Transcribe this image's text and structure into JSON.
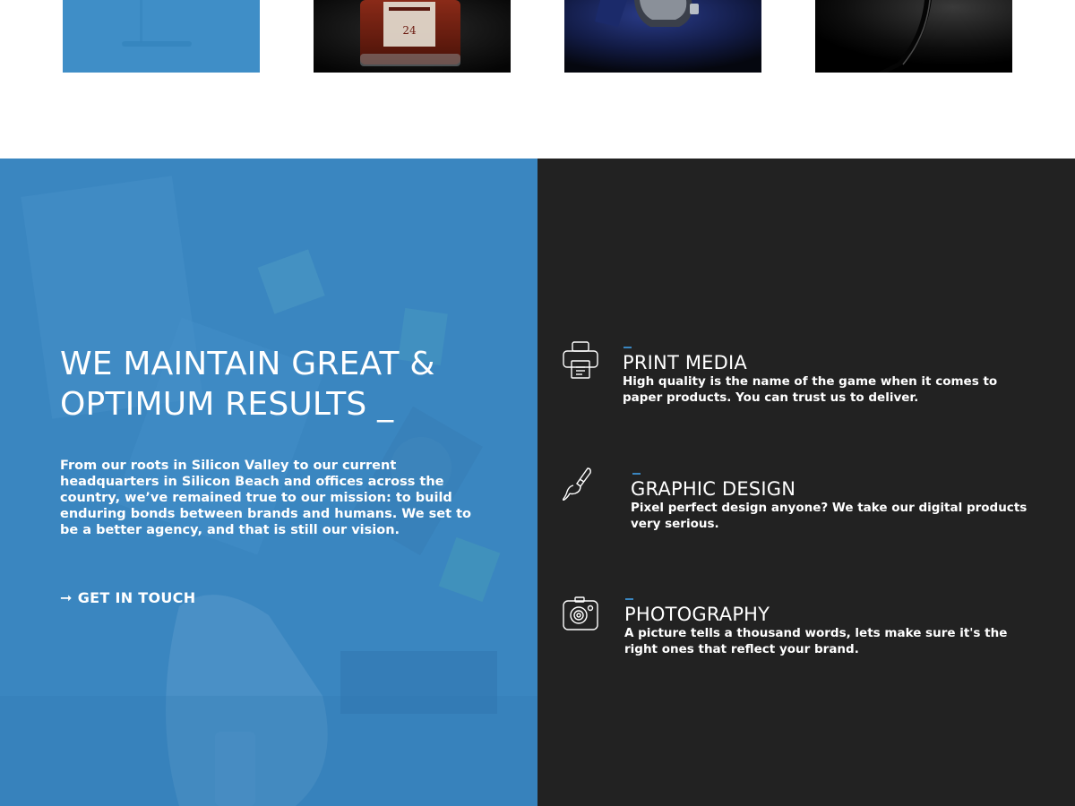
{
  "portfolio": {
    "thumbnails": [
      {
        "icon": "blue-desk-image"
      },
      {
        "icon": "whiskey-bottle-image",
        "label_text": "24"
      },
      {
        "icon": "wristwatch-image"
      },
      {
        "icon": "dark-product-image"
      }
    ]
  },
  "about": {
    "headline_line1": "WE MAINTAIN GREAT &",
    "headline_line2": "OPTIMUM RESULTS _",
    "body": "From our roots in Silicon Valley to our current headquarters in Silicon Beach and offices across the country, we’ve remained true to our mission: to build enduring bonds between brands and humans. We set to be a better agency, and that is still our vision.",
    "cta_arrow": "➞",
    "cta_label": "GET IN TOUCH",
    "panel_color": "#3a86c0"
  },
  "services": {
    "panel_color": "#222222",
    "accent_color": "#3a86c0",
    "items": [
      {
        "icon": "printer-icon",
        "title": "PRINT MEDIA",
        "description": "High quality is the name of the game when it comes to paper products. You can trust us to deliver."
      },
      {
        "icon": "paintbrush-icon",
        "title": "GRAPHIC DESIGN",
        "description": "Pixel perfect design anyone? We take our digital products very serious."
      },
      {
        "icon": "camera-icon",
        "title": "PHOTOGRAPHY",
        "description": "A picture tells a thousand words, lets make sure it's the right ones that reflect your brand."
      }
    ]
  }
}
